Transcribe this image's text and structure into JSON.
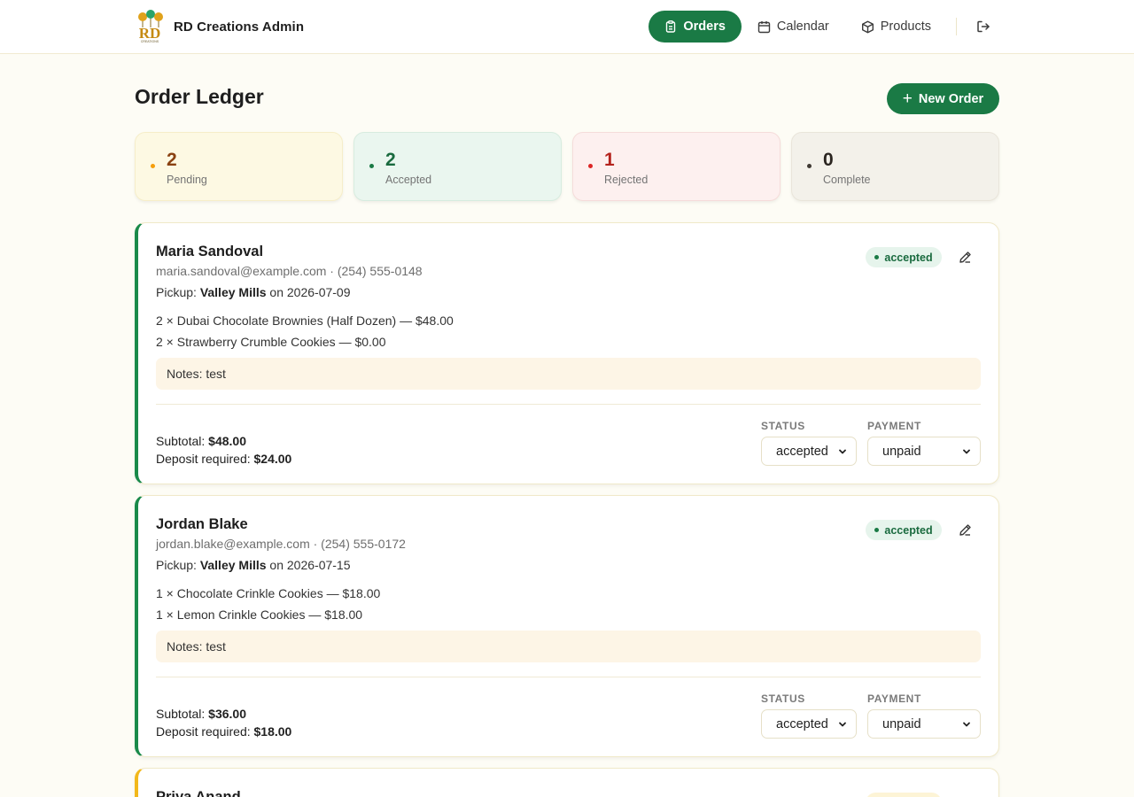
{
  "app": {
    "title": "RD Creations Admin",
    "logo_text": "RD",
    "logo_subtext": "CREATIONS"
  },
  "nav": {
    "items": [
      {
        "label": "Orders",
        "icon": "clipboard-icon",
        "active": true
      },
      {
        "label": "Calendar",
        "icon": "calendar-icon",
        "active": false
      },
      {
        "label": "Products",
        "icon": "box-icon",
        "active": false
      }
    ],
    "logout_icon": "logout-icon"
  },
  "page": {
    "title": "Order Ledger",
    "new_order_label": "New Order"
  },
  "stats": [
    {
      "count": "2",
      "label": "Pending",
      "color": "#f59e0b"
    },
    {
      "count": "2",
      "label": "Accepted",
      "color": "#1a7a45"
    },
    {
      "count": "1",
      "label": "Rejected",
      "color": "#dc2626"
    },
    {
      "count": "0",
      "label": "Complete",
      "color": "#3f3a33"
    }
  ],
  "labels": {
    "pickup": "Pickup:",
    "on": "on",
    "subtotal": "Subtotal:",
    "deposit": "Deposit required:",
    "status": "STATUS",
    "payment": "PAYMENT"
  },
  "orders": [
    {
      "customer": "Maria Sandoval",
      "contact": "maria.sandoval@example.com · (254) 555-0148",
      "pickup_location": "Valley Mills",
      "pickup_date": "2026-07-09",
      "items": [
        "2 × Dubai Chocolate Brownies (Half Dozen) — $48.00",
        "2 × Strawberry Crumble Cookies — $0.00"
      ],
      "notes": "Notes: test",
      "subtotal": "$48.00",
      "deposit": "$24.00",
      "badge": "accepted",
      "status_value": "accepted",
      "payment_value": "unpaid"
    },
    {
      "customer": "Jordan Blake",
      "contact": "jordan.blake@example.com · (254) 555-0172",
      "pickup_location": "Valley Mills",
      "pickup_date": "2026-07-15",
      "items": [
        "1 × Chocolate Crinkle Cookies — $18.00",
        "1 × Lemon Crinkle Cookies — $18.00"
      ],
      "notes": "Notes: test",
      "subtotal": "$36.00",
      "deposit": "$18.00",
      "badge": "accepted",
      "status_value": "accepted",
      "payment_value": "unpaid"
    },
    {
      "customer": "Priya Anand"
    }
  ]
}
